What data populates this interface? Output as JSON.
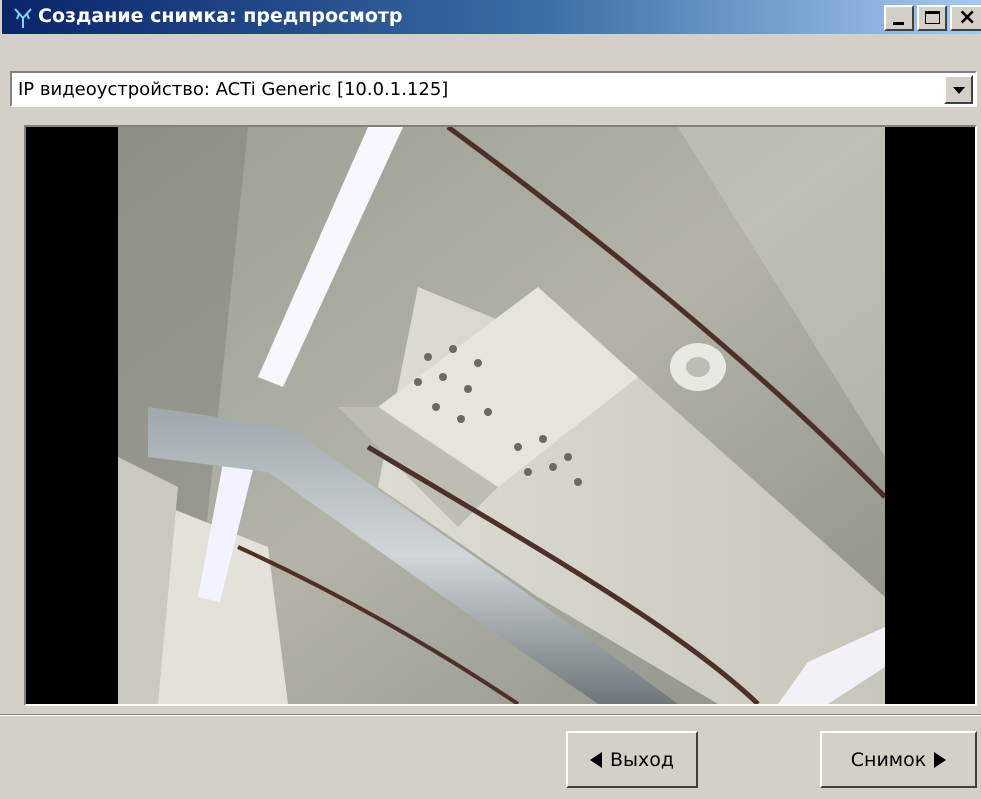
{
  "window": {
    "title": "Создание снимка: предпросмотр",
    "controls": {
      "minimize": "minimize-icon",
      "maximize": "maximize-icon",
      "close": "close-icon"
    }
  },
  "device_select": {
    "value": "IP видеоустройство: ACTi Generic [10.0.1.125]"
  },
  "footer": {
    "exit_label": "Выход",
    "snapshot_label": "Снимок"
  },
  "colors": {
    "titlebar_start": "#0a246a",
    "titlebar_end": "#a6caf0",
    "face": "#d4d0c8"
  }
}
